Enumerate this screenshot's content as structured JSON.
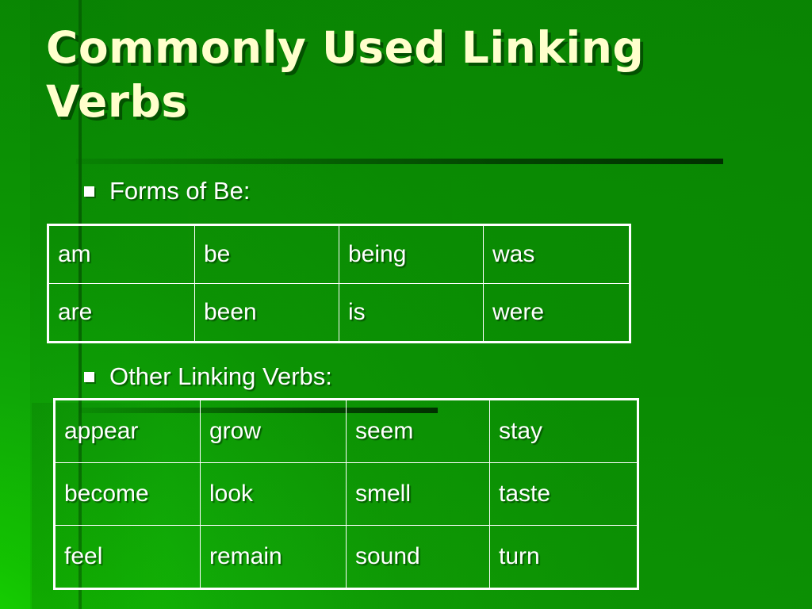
{
  "slide": {
    "title": "Commonly Used Linking Verbs",
    "background_color": "#0b8a03",
    "background_accent_color": "#18e000",
    "title_color": "#ffffcc",
    "body_text_color": "#ffffff",
    "table_border_color": "#ffffff"
  },
  "sections": [
    {
      "bullet_label": "Forms of Be:",
      "bullet_glyph": "square-bullet-icon",
      "table": {
        "columns": 4,
        "rows": [
          [
            "am",
            "be",
            "being",
            "was"
          ],
          [
            "are",
            "been",
            "is",
            "were"
          ]
        ]
      }
    },
    {
      "bullet_label": "Other Linking Verbs:",
      "bullet_glyph": "square-bullet-icon",
      "table": {
        "columns": 4,
        "rows": [
          [
            "appear",
            "grow",
            "seem",
            "stay"
          ],
          [
            "become",
            "look",
            "smell",
            "taste"
          ],
          [
            "feel",
            "remain",
            "sound",
            "turn"
          ]
        ]
      }
    }
  ]
}
